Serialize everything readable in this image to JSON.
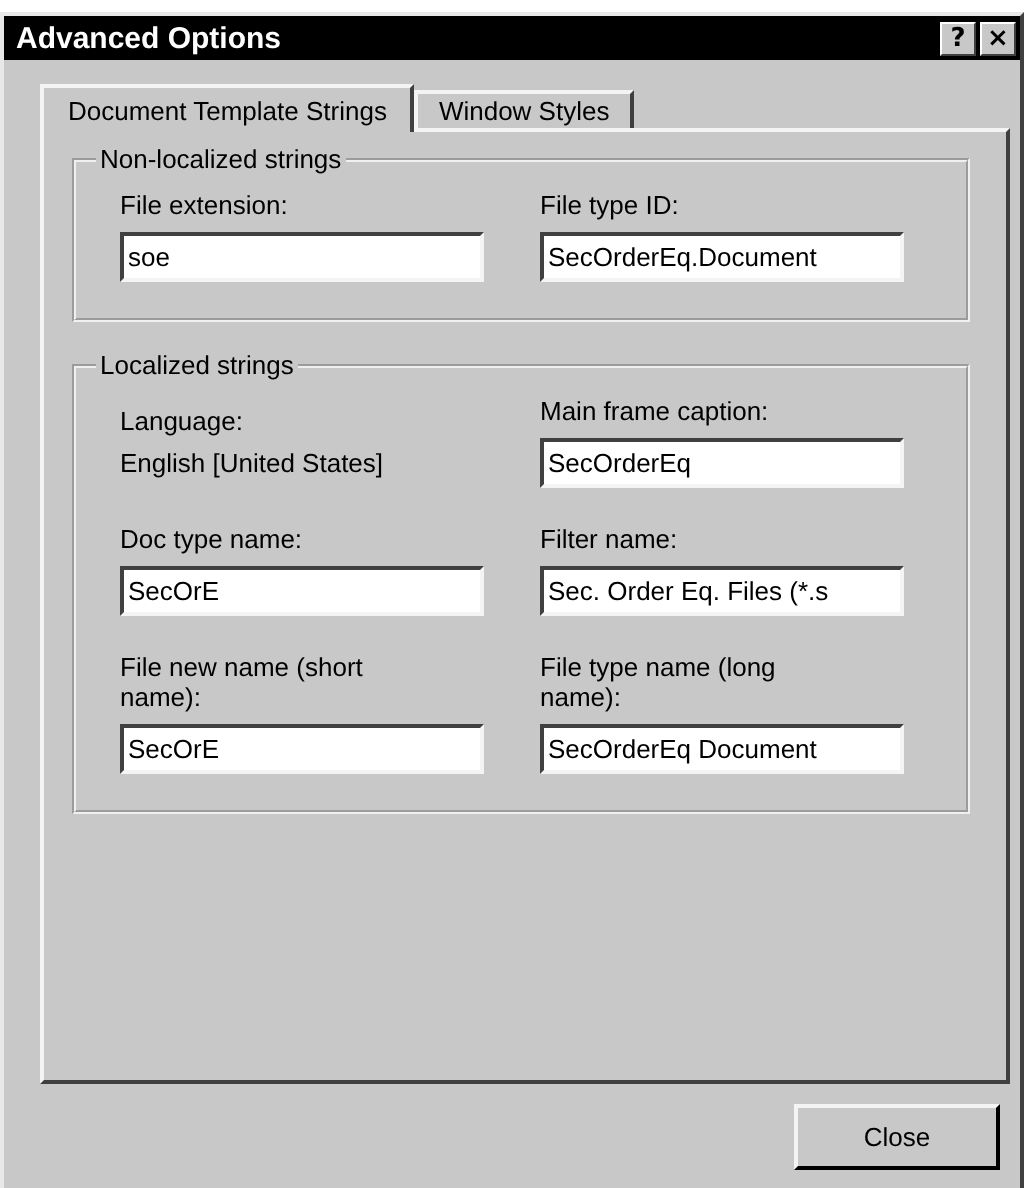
{
  "window": {
    "title": "Advanced Options",
    "help_button": "?",
    "close_button": "×"
  },
  "tabs": [
    {
      "label": "Document Template Strings",
      "selected": true
    },
    {
      "label": "Window Styles",
      "selected": false
    }
  ],
  "groups": [
    {
      "title": "Non-localized strings",
      "items": [
        {
          "kind": "field",
          "label": "File extension:",
          "value": "soe"
        },
        {
          "kind": "field",
          "label": "File type ID:",
          "value": "SecOrderEq.Document"
        }
      ]
    },
    {
      "title": "Localized strings",
      "items": [
        {
          "kind": "static",
          "label": "Language:",
          "value": "English [United States]"
        },
        {
          "kind": "field",
          "label": "Main frame caption:",
          "value": "SecOrderEq"
        },
        {
          "kind": "field",
          "label": "Doc type name:",
          "value": "SecOrE"
        },
        {
          "kind": "field",
          "label": "Filter name:",
          "value": "Sec. Order Eq. Files (*.s"
        },
        {
          "kind": "field",
          "label": "File new name (short name):",
          "value": "SecOrE"
        },
        {
          "kind": "field",
          "label": "File type name (long name):",
          "value": "SecOrderEq Document"
        }
      ]
    }
  ],
  "buttons": [
    {
      "label": "Close"
    }
  ]
}
